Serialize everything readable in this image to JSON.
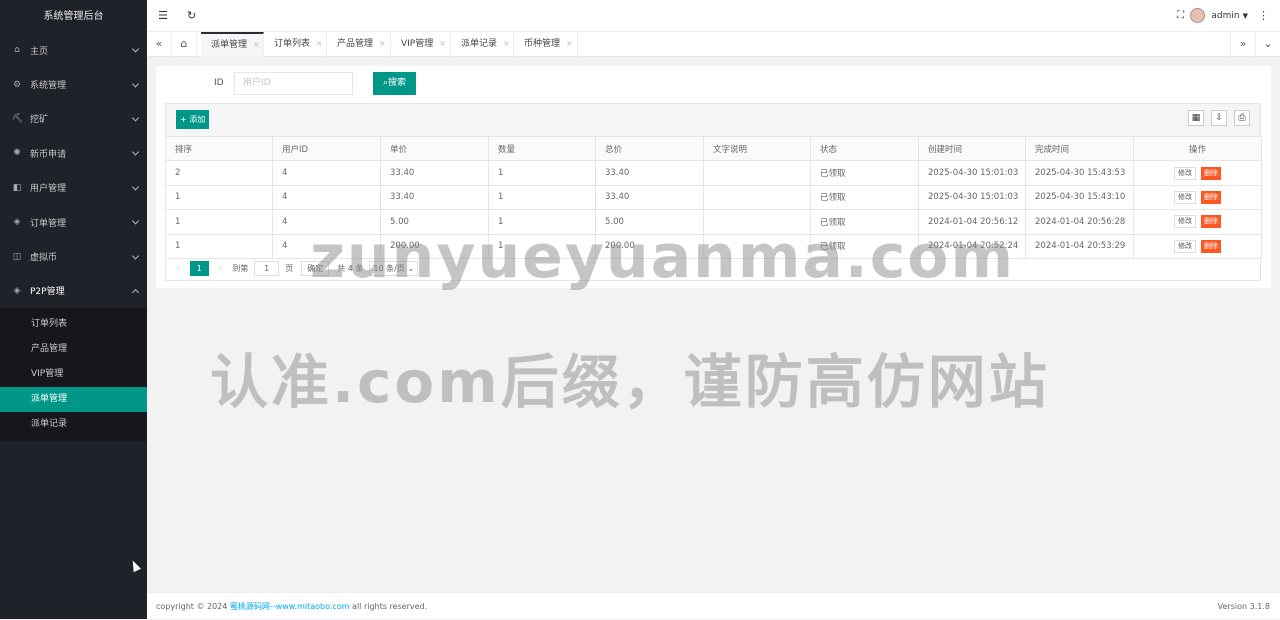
{
  "app": {
    "title": "系统管理后台"
  },
  "sidebar": {
    "items": [
      {
        "label": "主页",
        "icon": "home-icon",
        "glyph": "⌂"
      },
      {
        "label": "系统管理",
        "icon": "gear-icon",
        "glyph": "⚙"
      },
      {
        "label": "挖矿",
        "icon": "mining-icon",
        "glyph": "⛏"
      },
      {
        "label": "新币申请",
        "icon": "coin-icon",
        "glyph": "✺"
      },
      {
        "label": "用户管理",
        "icon": "user-icon",
        "glyph": "◧"
      },
      {
        "label": "订单管理",
        "icon": "order-icon",
        "glyph": "◈"
      },
      {
        "label": "虚拟币",
        "icon": "currency-icon",
        "glyph": "◫"
      },
      {
        "label": "P2P管理",
        "icon": "p2p-icon",
        "glyph": "◈"
      }
    ],
    "subitems": [
      {
        "label": "订单列表"
      },
      {
        "label": "产品管理"
      },
      {
        "label": "VIP管理"
      },
      {
        "label": "派单管理",
        "active": true
      },
      {
        "label": "派单记录"
      }
    ]
  },
  "topbar": {
    "user": "admin",
    "fold_icon": "menu-fold-icon",
    "refresh_icon": "refresh-icon"
  },
  "tabs": [
    {
      "label": "派单管理",
      "active": true
    },
    {
      "label": "订单列表"
    },
    {
      "label": "产品管理"
    },
    {
      "label": "VIP管理"
    },
    {
      "label": "派单记录"
    },
    {
      "label": "币种管理"
    }
  ],
  "search": {
    "label": "ID",
    "placeholder": "用户ID",
    "button": "搜索"
  },
  "toolbar": {
    "add_label": "添加"
  },
  "table": {
    "headers": [
      "排序",
      "用户ID",
      "单价",
      "数量",
      "总价",
      "文字说明",
      "状态",
      "创建时间",
      "完成时间",
      "操作"
    ],
    "rows": [
      [
        "2",
        "4",
        "33.40",
        "1",
        "33.40",
        "",
        "已领取",
        "2025-04-30 15:01:03",
        "2025-04-30 15:43:53"
      ],
      [
        "1",
        "4",
        "33.40",
        "1",
        "33.40",
        "",
        "已领取",
        "2025-04-30 15:01:03",
        "2025-04-30 15:43:10"
      ],
      [
        "1",
        "4",
        "5.00",
        "1",
        "5.00",
        "",
        "已领取",
        "2024-01-04 20:56:12",
        "2024-01-04 20:56:28"
      ],
      [
        "1",
        "4",
        "200.00",
        "1",
        "200.00",
        "",
        "已领取",
        "2024-01-04 20:52:24",
        "2024-01-04 20:53:29"
      ]
    ],
    "edit_label": "修改",
    "delete_label": "删除"
  },
  "pager": {
    "current": "1",
    "goto_label": "到第",
    "page_input": "1",
    "page_unit": "页",
    "ok": "确定",
    "total": "共 4 条",
    "per_page": "10 条/页"
  },
  "footer": {
    "prefix": "copyright © 2024 ",
    "link": "蜜桃源码网--www.mitaobo.com",
    "suffix": " all rights reserved.",
    "version": "Version 3.1.8"
  },
  "watermark": {
    "line1": "zunyueyuanma.com",
    "line2": "认准.com后缀，谨防高仿网站"
  }
}
